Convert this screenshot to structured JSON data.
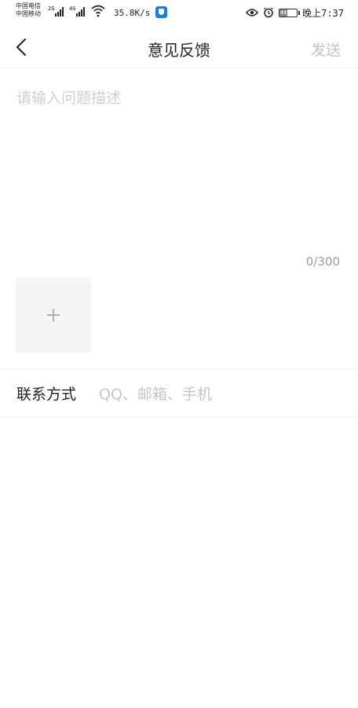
{
  "status_bar": {
    "carrier_1": "中国电信",
    "carrier_2": "中国移动",
    "net_1": "2G",
    "net_2": "4G",
    "speed": "35.8K/s",
    "battery": "44",
    "time": "晚上7:37"
  },
  "nav": {
    "title": "意见反馈",
    "send_label": "发送"
  },
  "feedback": {
    "placeholder": "请输入问题描述",
    "counter": "0/300",
    "add_image_symbol": "+"
  },
  "contact": {
    "label": "联系方式",
    "placeholder": "QQ、邮箱、手机"
  }
}
